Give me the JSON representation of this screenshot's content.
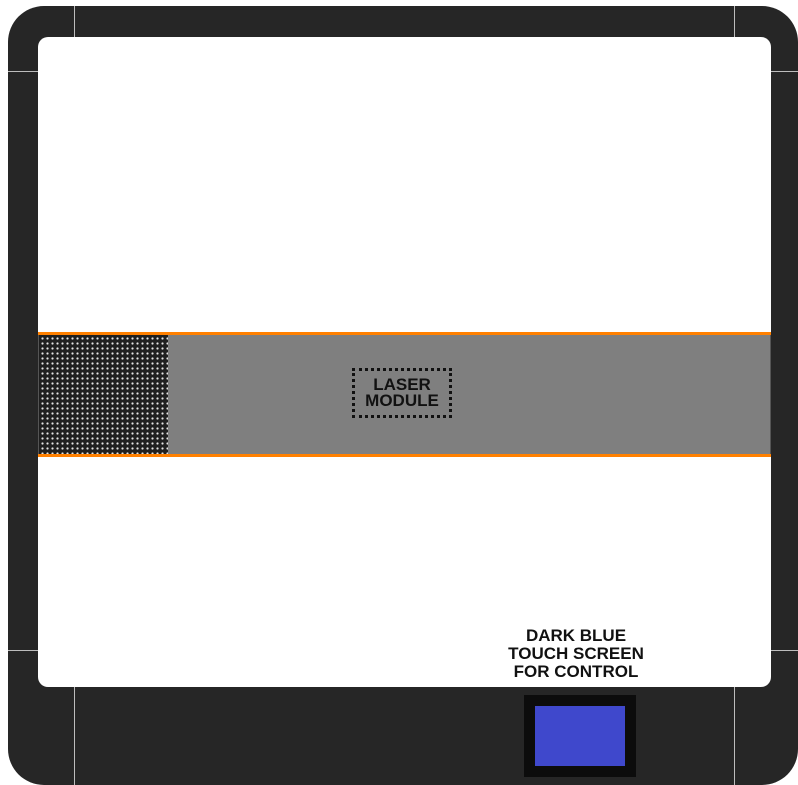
{
  "laser_module": {
    "line1": "LASER",
    "line2": "MODULE"
  },
  "touch_screen": {
    "line1": "DARK BLUE",
    "line2": "TOUCH SCREEN",
    "line3": "FOR CONTROL",
    "color": "#3f48cc"
  },
  "colors": {
    "frame": "#262626",
    "work_area": "#ffffff",
    "rail": "#ff8000",
    "beam": "#7f7f7f",
    "vent": "#1f1f1f"
  }
}
